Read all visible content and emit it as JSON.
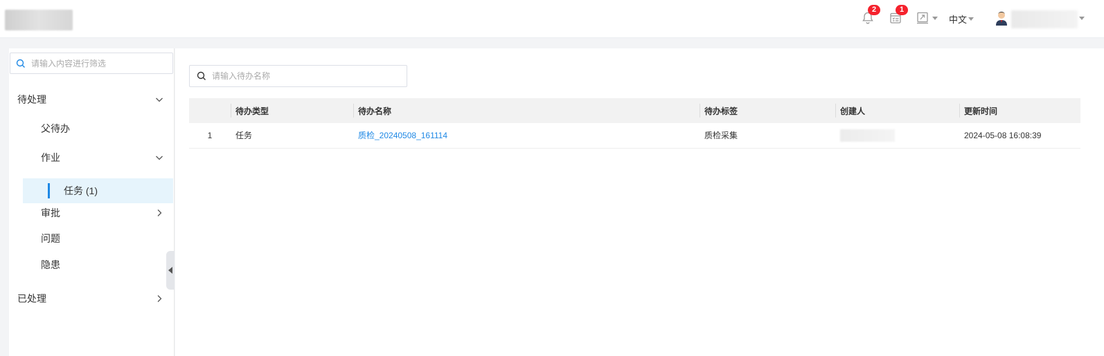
{
  "header": {
    "notification_count": "2",
    "tasks_count": "1",
    "language": "中文"
  },
  "sidebar": {
    "filter_placeholder": "请输入内容进行筛选",
    "pending": {
      "label": "待处理"
    },
    "parent_todo": {
      "label": "父待办"
    },
    "job": {
      "label": "作业"
    },
    "task": {
      "label": "任务 (1)"
    },
    "approval": {
      "label": "审批"
    },
    "issue": {
      "label": "问题"
    },
    "hazard": {
      "label": "隐患"
    },
    "processed": {
      "label": "已处理"
    }
  },
  "main": {
    "search_placeholder": "请输入待办名称",
    "columns": [
      "",
      "待办类型",
      "待办名称",
      "待办标签",
      "创建人",
      "更新时间"
    ],
    "rows": [
      {
        "index": "1",
        "type": "任务",
        "name": "质检_20240508_161114",
        "tag": "质检采集",
        "updated": "2024-05-08 16:08:39"
      }
    ]
  },
  "colors": {
    "accent": "#1e88e5",
    "badge": "#f5222d",
    "active_bg": "#e6f4fc"
  }
}
